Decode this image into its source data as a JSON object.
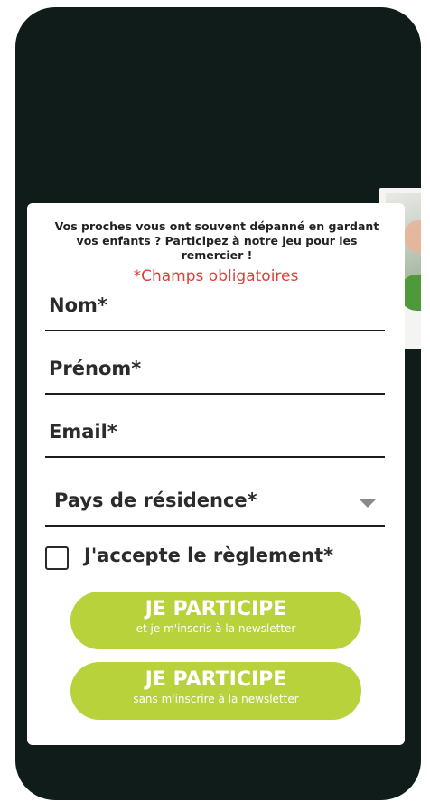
{
  "form": {
    "intro": "Vos proches vous ont souvent dépanné en gardant vos enfants ? Participez à notre jeu pour les remercier !",
    "required_note": "*Champs obligatoires",
    "fields": {
      "nom": "Nom*",
      "prenom": "Prénom*",
      "email": "Email*",
      "pays": "Pays de résidence*"
    },
    "checkbox_label": "J'accepte le règlement*",
    "buttons": [
      {
        "main": "JE PARTICIPE",
        "sub": "et je m'inscris à la newsletter"
      },
      {
        "main": "JE PARTICIPE",
        "sub": "sans m'inscrire à la newsletter"
      }
    ]
  },
  "colors": {
    "background": "#0f1c1a",
    "button": "#b7d23a",
    "required": "#d9413a"
  }
}
